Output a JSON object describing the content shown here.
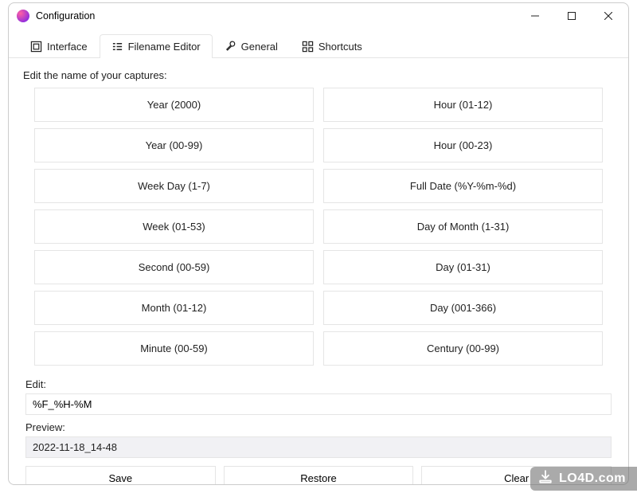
{
  "window": {
    "title": "Configuration"
  },
  "tabs": {
    "interface": "Interface",
    "filename_editor": "Filename Editor",
    "general": "General",
    "shortcuts": "Shortcuts"
  },
  "editor": {
    "heading": "Edit the name of your captures:",
    "tokens": {
      "left": [
        "Year (2000)",
        "Year (00-99)",
        "Week Day (1-7)",
        "Week (01-53)",
        "Second (00-59)",
        "Month (01-12)",
        "Minute (00-59)"
      ],
      "right": [
        "Hour (01-12)",
        "Hour (00-23)",
        "Full Date (%Y-%m-%d)",
        "Day of Month (1-31)",
        "Day (01-31)",
        "Day (001-366)",
        "Century (00-99)"
      ]
    },
    "edit_label": "Edit:",
    "edit_value": "%F_%H-%M",
    "preview_label": "Preview:",
    "preview_value": "2022-11-18_14-48",
    "save": "Save",
    "restore": "Restore",
    "clear": "Clear"
  },
  "watermark": "LO4D.com"
}
